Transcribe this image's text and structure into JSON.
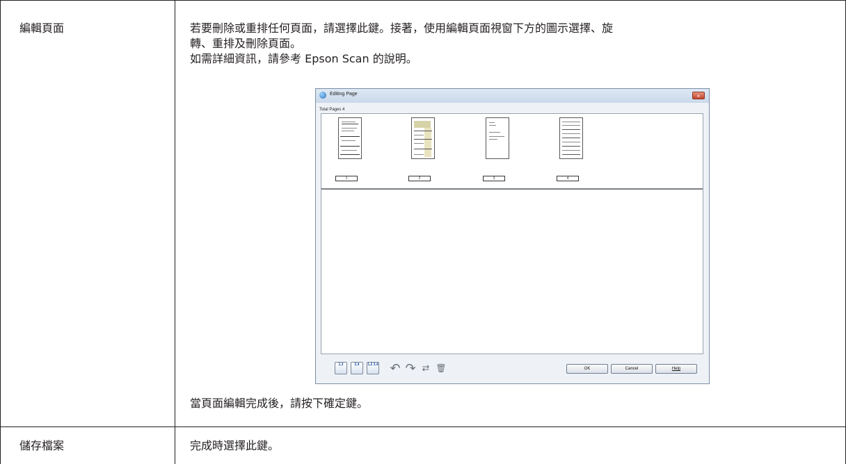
{
  "rows": [
    {
      "label": "編輯頁面",
      "desc_line1": "若要刪除或重排任何頁面，請選擇此鍵。接著，使用編輯頁面視窗下方的圖示選擇、旋",
      "desc_line2": "轉、重排及刪除頁面。",
      "desc_line3": "如需詳細資訊，請參考 Epson Scan 的說明。",
      "after_note": "當頁面編輯完成後，請按下確定鍵。"
    },
    {
      "label": "儲存檔案",
      "desc": "完成時選擇此鍵。"
    }
  ],
  "dialog": {
    "title": "Editing Page",
    "close_glyph": "×",
    "total_pages": "Total Pages 4",
    "pages": [
      {
        "number": "1"
      },
      {
        "number": "2"
      },
      {
        "number": "3"
      },
      {
        "number": "4"
      }
    ],
    "toolbar": {
      "select_odd_icon": "1,3",
      "select_even_icon": "2,4",
      "select_all_icon": "1,2 3,4",
      "rotate_left_glyph": "↶",
      "rotate_right_glyph": "↷",
      "reorder_glyph": "⇄",
      "delete_glyph": "🗑"
    },
    "buttons": {
      "ok": "OK",
      "cancel": "Cancel",
      "help": "Help"
    }
  }
}
